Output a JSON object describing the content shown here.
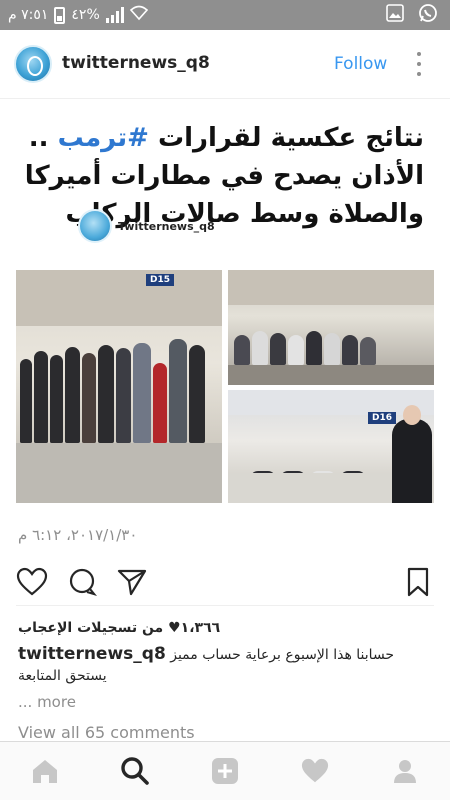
{
  "status_bar": {
    "time": "٧:٥١ م",
    "battery": "٤٢%",
    "icons": [
      "signal-icon",
      "battery-icon",
      "wifi-icon",
      "gallery-icon",
      "whatsapp-icon"
    ]
  },
  "post": {
    "username": "twitternews_q8",
    "follow_label": "Follow",
    "headline_before": "نتائج عكسية لقرارات ",
    "headline_hashtag": "#ترمب",
    "headline_after": " .. الأذان يصدح في مطارات أميركا والصلاة وسط صالات الركاب",
    "watermark": "Twitternews_q8",
    "photo_sign_1": "D15",
    "photo_sign_2": "D16",
    "date": "٢٠١٧/١/٣٠، ٦:١٢ م",
    "likes": "١،٣٦٦♥ من تسجيلات الإعجاب",
    "caption_user": "twitternews_q8",
    "caption_line1": "حسابنا هذا الإسبوع برعاية حساب مميز",
    "caption_line2": "يستحق المتابعة",
    "more_label": "... more",
    "comments_label": "View all 65 comments"
  },
  "nav": {
    "items": [
      "home-icon",
      "search-icon",
      "add-icon",
      "heart-icon",
      "profile-icon"
    ]
  },
  "colors": {
    "accent": "#3897f0",
    "hashtag": "#2f78d0",
    "status_bar": "#8f8f8f"
  }
}
